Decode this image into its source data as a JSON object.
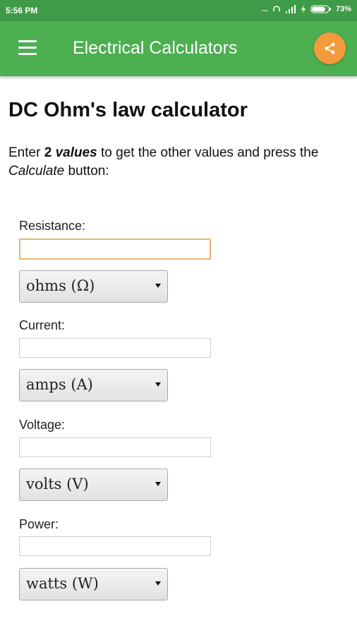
{
  "status_bar": {
    "time": "5:56 PM",
    "signal_dots": "...",
    "battery": "73%"
  },
  "app_bar": {
    "title": "Electrical Calculators",
    "menu_icon": "hamburger-menu-icon",
    "share_icon": "share-icon",
    "share_color": "#f29a3c",
    "bar_color": "#4caf50"
  },
  "page": {
    "title": "DC Ohm's law calculator",
    "intro": {
      "part1": "Enter ",
      "bold": "2",
      "bold_italic": "values",
      "part2": " to get the other values and press the ",
      "italic": "Calculate",
      "part3": " button:"
    }
  },
  "fields": [
    {
      "label": "Resistance:",
      "value": "",
      "unit": "ohms (Ω)"
    },
    {
      "label": "Current:",
      "value": "",
      "unit": "amps (A)"
    },
    {
      "label": "Voltage:",
      "value": "",
      "unit": "volts (V)"
    },
    {
      "label": "Power:",
      "value": "",
      "unit": "watts (W)"
    }
  ]
}
